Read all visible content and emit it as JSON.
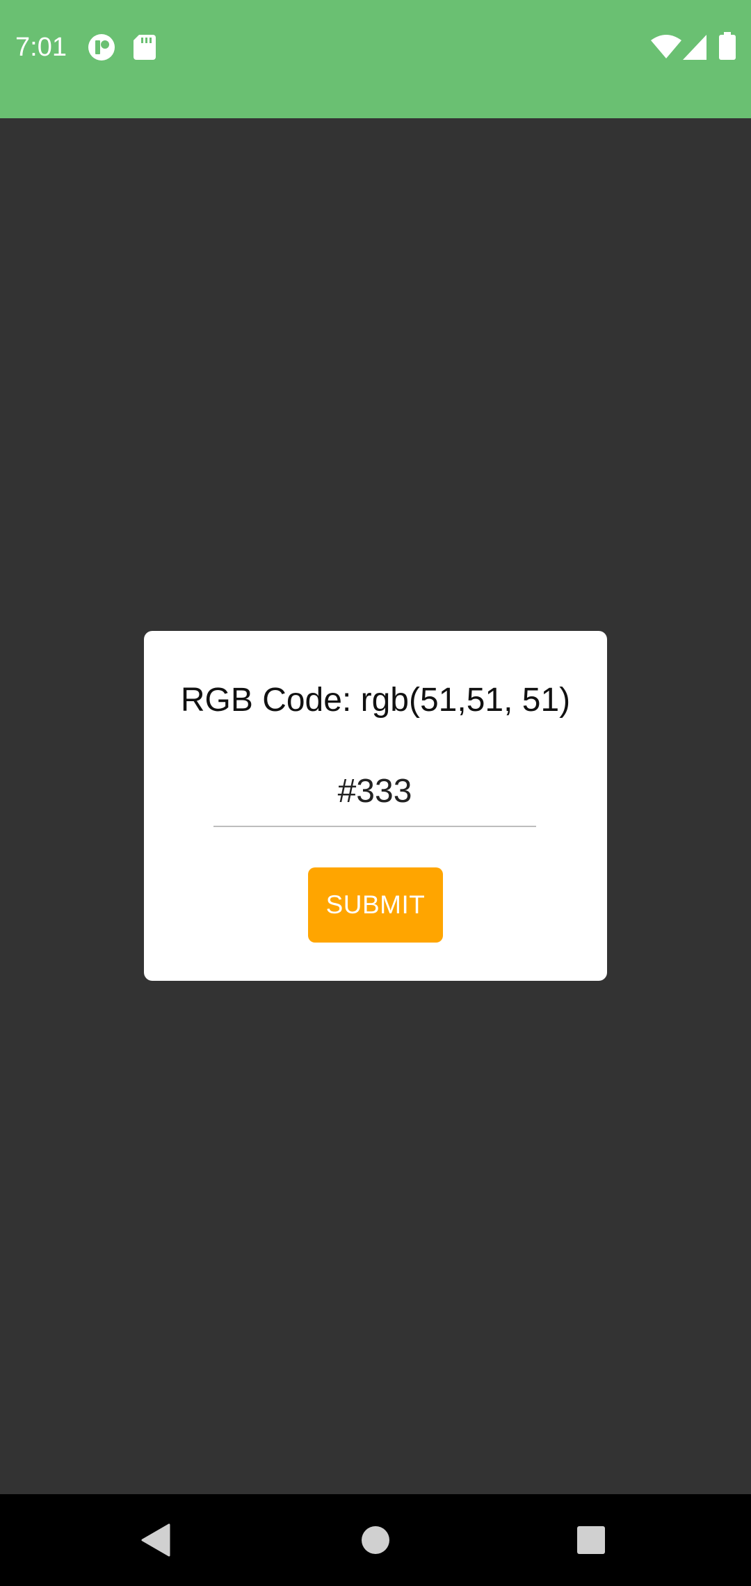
{
  "status_bar": {
    "time": "7:01",
    "background_color": "#6AC072",
    "left_icons": [
      "app-notification-icon",
      "sd-card-icon"
    ],
    "right_icons": [
      "wifi-icon",
      "cell-signal-icon",
      "battery-icon"
    ]
  },
  "app": {
    "background_color": "#333333"
  },
  "dialog": {
    "rgb_text": "RGB Code: rgb(51,51, 51)",
    "hex_value": "#333",
    "submit_label": "SUBMIT",
    "submit_color": "#FFA500"
  },
  "nav_bar": {
    "buttons": [
      "back-icon",
      "home-icon",
      "recents-icon"
    ]
  }
}
